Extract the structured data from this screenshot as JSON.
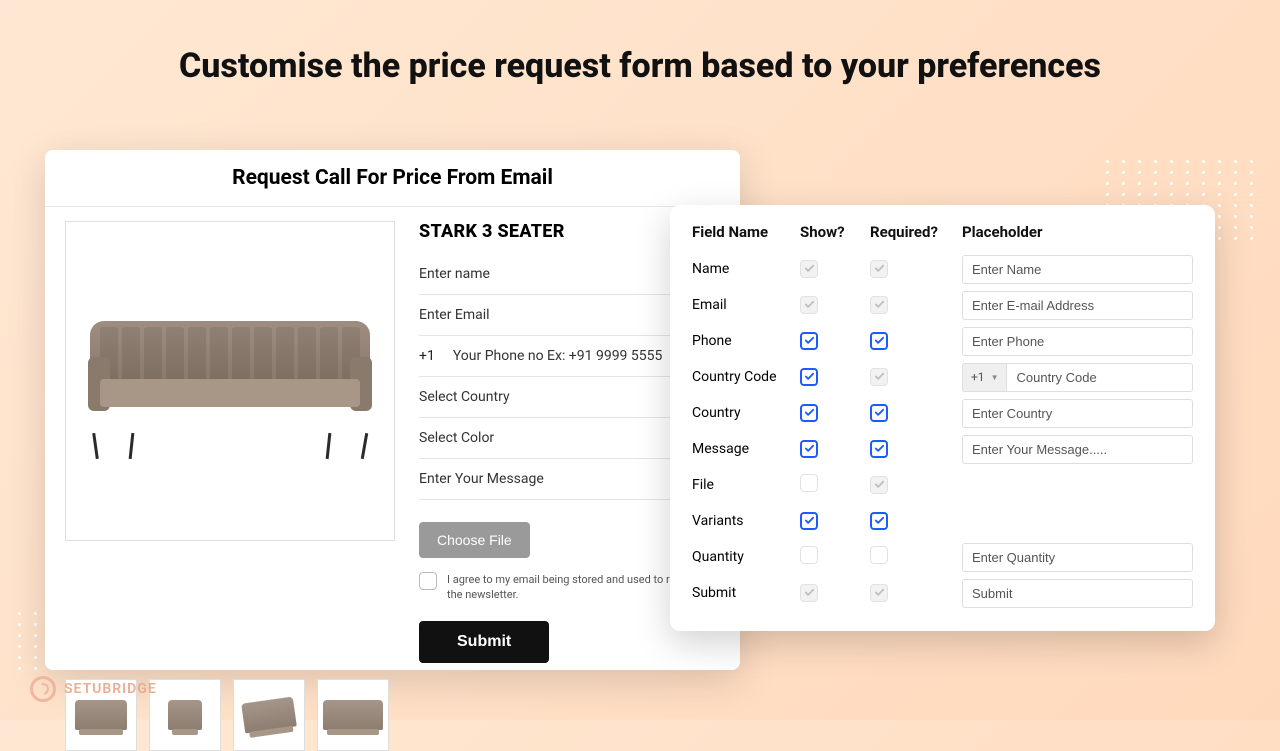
{
  "heading": "Customise the price request form based to your preferences",
  "leftCard": {
    "title": "Request Call For Price From Email",
    "productTitle": "STARK 3 SEATER",
    "fields": {
      "name": "Enter name",
      "email": "Enter Email",
      "phoneCode": "+1",
      "phonePlaceholder": "Your Phone no Ex: +91 9999 5555",
      "country": "Select Country",
      "color": "Select Color",
      "message": "Enter Your Message"
    },
    "chooseFile": "Choose File",
    "consent": "I agree to my email being stored and used to receive the newsletter.",
    "submit": "Submit"
  },
  "configCard": {
    "headers": {
      "field": "Field Name",
      "show": "Show?",
      "required": "Required?",
      "placeholder": "Placeholder"
    },
    "countryCodePrefix": "+1",
    "rows": [
      {
        "label": "Name",
        "show": "locked-on",
        "required": "locked-on",
        "placeholder": "Enter Name"
      },
      {
        "label": "Email",
        "show": "locked-on",
        "required": "locked-on",
        "placeholder": "Enter E-mail Address"
      },
      {
        "label": "Phone",
        "show": "blue-on",
        "required": "blue-on",
        "placeholder": "Enter Phone"
      },
      {
        "label": "Country Code",
        "show": "blue-on",
        "required": "locked-on",
        "placeholder": "Country Code",
        "prefix": true
      },
      {
        "label": "Country",
        "show": "blue-on",
        "required": "blue-on",
        "placeholder": "Enter Country"
      },
      {
        "label": "Message",
        "show": "blue-on",
        "required": "blue-on",
        "placeholder": "Enter Your Message....."
      },
      {
        "label": "File",
        "show": "empty",
        "required": "locked-on",
        "placeholder": ""
      },
      {
        "label": "Variants",
        "show": "blue-on",
        "required": "blue-on",
        "placeholder": ""
      },
      {
        "label": "Quantity",
        "show": "empty",
        "required": "empty",
        "placeholder": "Enter Quantity"
      },
      {
        "label": "Submit",
        "show": "locked-on",
        "required": "locked-on",
        "placeholder": "Submit"
      }
    ]
  },
  "logo": "SETUBRIDGE"
}
